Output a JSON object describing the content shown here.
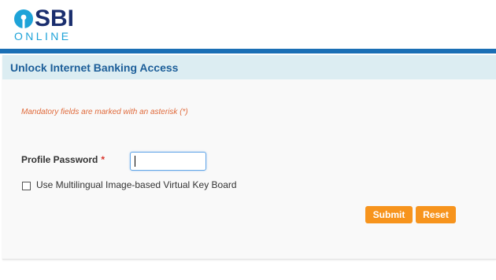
{
  "brand": {
    "name": "SBI",
    "sub": "ONLINE",
    "colors": {
      "navy": "#1a2e6e",
      "cyan": "#1ea3d8",
      "bar": "#1a6fb5"
    }
  },
  "page": {
    "title": "Unlock Internet Banking Access",
    "mandatory_note": "Mandatory fields are marked with an asterisk (*)"
  },
  "form": {
    "profile_password": {
      "label": "Profile Password",
      "required_mark": "*",
      "value": ""
    },
    "virtual_keyboard": {
      "label": "Use Multilingual Image-based Virtual Key Board",
      "checked": false
    }
  },
  "actions": {
    "submit_label": "Submit",
    "reset_label": "Reset",
    "button_color": "#f7941d"
  }
}
